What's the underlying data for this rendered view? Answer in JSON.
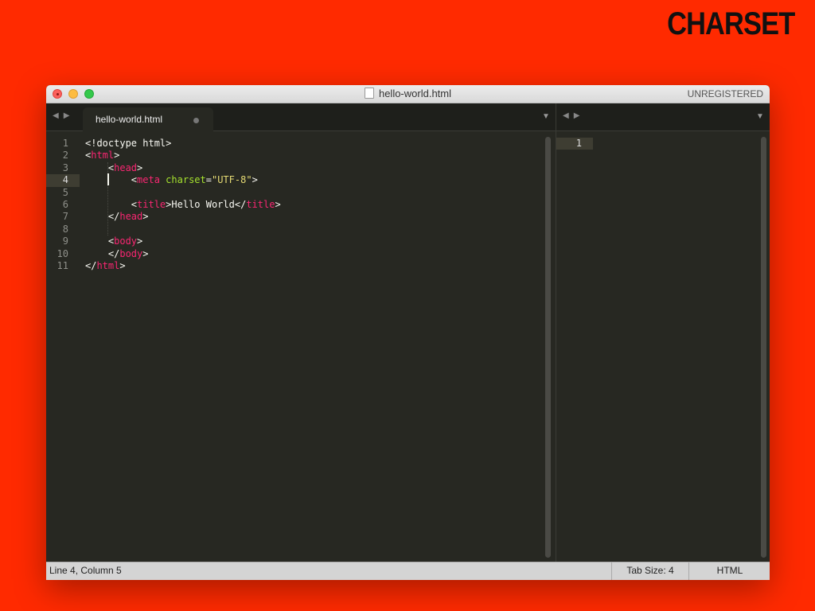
{
  "slide": {
    "title": "CHARSET"
  },
  "window": {
    "title": "hello-world.html",
    "registration": "UNREGISTERED"
  },
  "tabs": [
    {
      "label": "hello-world.html",
      "modified": true
    }
  ],
  "nav": {
    "back": "◀",
    "forward": "▶",
    "dropdown": "▼"
  },
  "editor": {
    "left_line_numbers": [
      "1",
      "2",
      "3",
      "4",
      "5",
      "6",
      "7",
      "8",
      "9",
      "10",
      "11"
    ],
    "right_line_numbers": [
      "1"
    ],
    "active_line": 4,
    "code_lines": [
      [
        {
          "t": "<!doctype html>",
          "c": "tx"
        }
      ],
      [
        {
          "t": "<",
          "c": "tx"
        },
        {
          "t": "html",
          "c": "tg"
        },
        {
          "t": ">",
          "c": "tx"
        }
      ],
      [
        {
          "t": "    <",
          "c": "tx"
        },
        {
          "t": "head",
          "c": "tg"
        },
        {
          "t": ">",
          "c": "tx"
        }
      ],
      [
        {
          "t": "        <",
          "c": "tx"
        },
        {
          "t": "meta",
          "c": "tg"
        },
        {
          "t": " ",
          "c": "tx"
        },
        {
          "t": "charset",
          "c": "at"
        },
        {
          "t": "=",
          "c": "tx"
        },
        {
          "t": "\"UTF-8\"",
          "c": "st"
        },
        {
          "t": ">",
          "c": "tx"
        }
      ],
      [
        {
          "t": "",
          "c": "tx"
        }
      ],
      [
        {
          "t": "        <",
          "c": "tx"
        },
        {
          "t": "title",
          "c": "tg"
        },
        {
          "t": ">Hello World</",
          "c": "tx"
        },
        {
          "t": "title",
          "c": "tg"
        },
        {
          "t": ">",
          "c": "tx"
        }
      ],
      [
        {
          "t": "    </",
          "c": "tx"
        },
        {
          "t": "head",
          "c": "tg"
        },
        {
          "t": ">",
          "c": "tx"
        }
      ],
      [
        {
          "t": "",
          "c": "tx"
        }
      ],
      [
        {
          "t": "    <",
          "c": "tx"
        },
        {
          "t": "body",
          "c": "tg"
        },
        {
          "t": ">",
          "c": "tx"
        }
      ],
      [
        {
          "t": "    </",
          "c": "tx"
        },
        {
          "t": "body",
          "c": "tg"
        },
        {
          "t": ">",
          "c": "tx"
        }
      ],
      [
        {
          "t": "</",
          "c": "tx"
        },
        {
          "t": "html",
          "c": "tg"
        },
        {
          "t": ">",
          "c": "tx"
        }
      ]
    ]
  },
  "status": {
    "position": "Line 4, Column 5",
    "tab_size": "Tab Size: 4",
    "syntax": "HTML"
  },
  "colors": {
    "background": "#ff2a00",
    "editor_bg": "#272822",
    "tag": "#f92672",
    "attribute": "#a6e22e",
    "string": "#e6db74"
  }
}
